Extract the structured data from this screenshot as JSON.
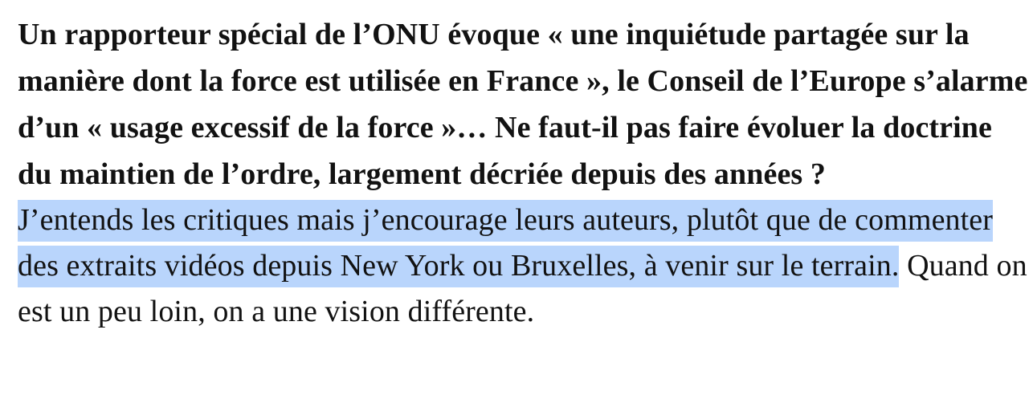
{
  "interview": {
    "question": "Un rapporteur spécial de l’ONU évoque « une inquiétude partagée sur la manière dont la force est utilisée en France », le Conseil de l’Europe s’alarme d’un « usage excessif de la force »… Ne faut-il pas faire évoluer la doctrine du maintien de l’ordre, largement décriée depuis des années ?",
    "answer_highlighted": "J’entends les critiques mais j’encourage leurs auteurs, plutôt que de commenter des extraits vidéos depuis New York ou Bruxelles, à venir sur le terrain.",
    "answer_rest": " Quand on est un peu loin, on a une vision différente."
  },
  "colors": {
    "selection_highlight": "#b9d5fc",
    "text": "#121212",
    "background": "#ffffff"
  }
}
